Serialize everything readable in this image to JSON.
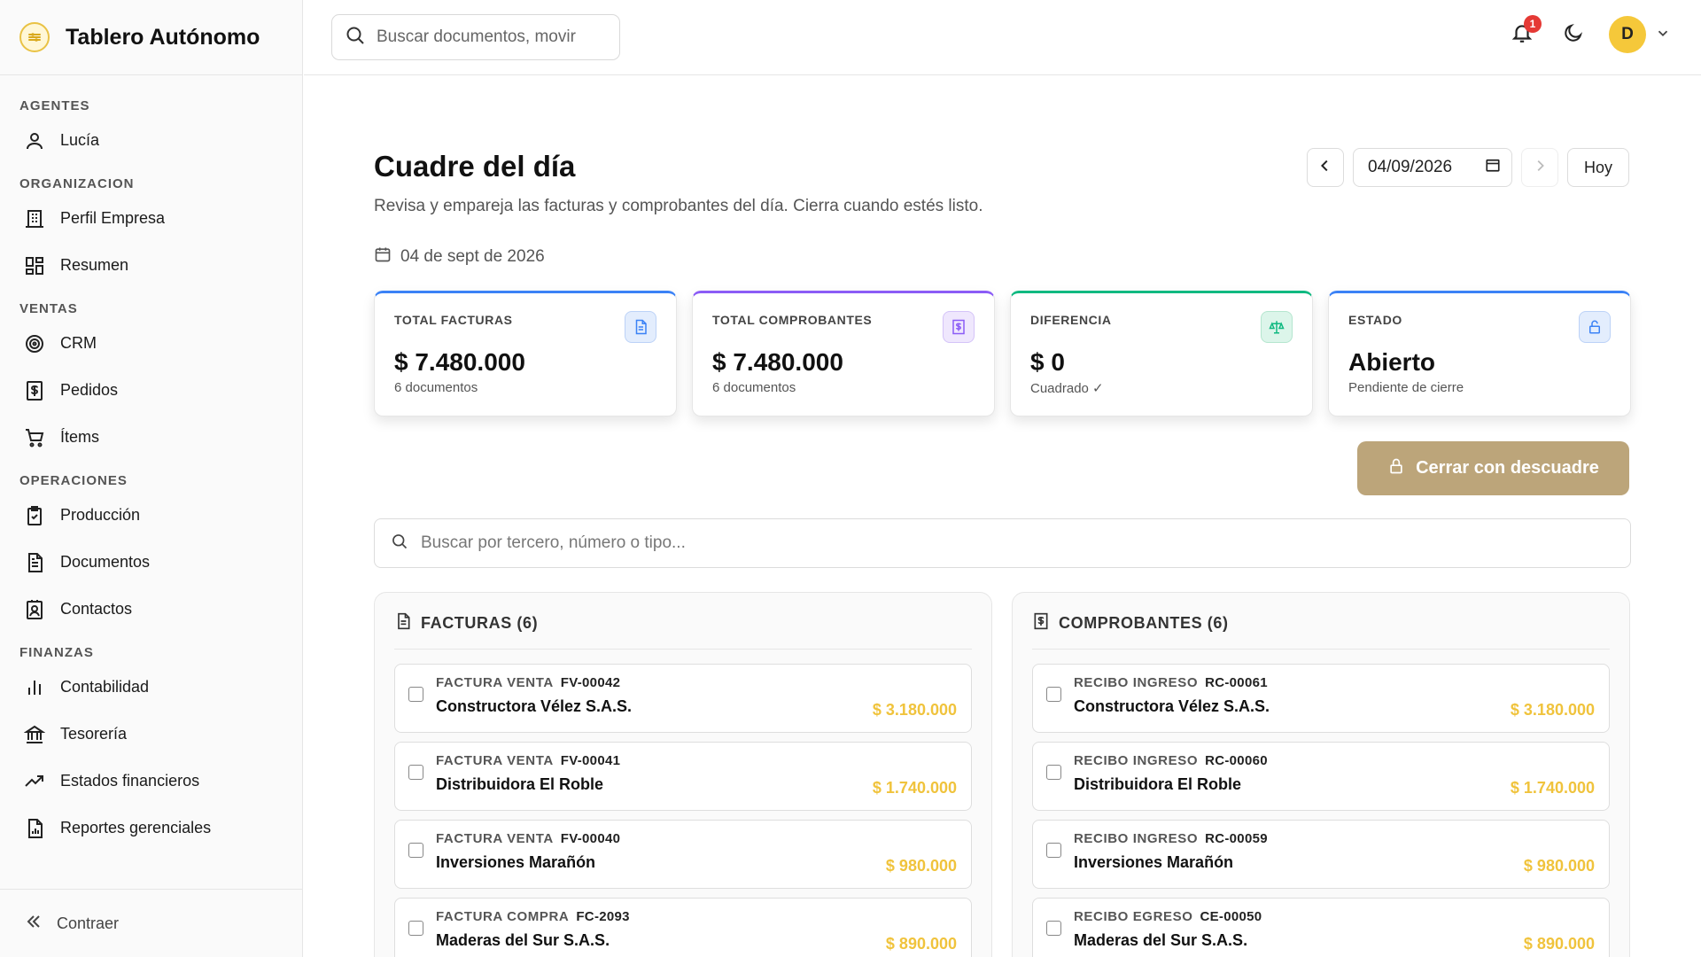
{
  "app": {
    "title": "Tablero Autónomo"
  },
  "search": {
    "placeholder": "Buscar documentos, movir"
  },
  "notifications": {
    "count": "1"
  },
  "user": {
    "initial": "D"
  },
  "sidebar": {
    "sections": {
      "agentes": "AGENTES",
      "organizacion": "ORGANIZACION",
      "ventas": "VENTAS",
      "operaciones": "OPERACIONES",
      "finanzas": "FINANZAS"
    },
    "items": {
      "lucia": "Lucía",
      "perfil": "Perfil Empresa",
      "resumen": "Resumen",
      "crm": "CRM",
      "pedidos": "Pedidos",
      "items": "Ítems",
      "produccion": "Producción",
      "documentos": "Documentos",
      "contactos": "Contactos",
      "contabilidad": "Contabilidad",
      "tesoreria": "Tesorería",
      "estados": "Estados financieros",
      "reportes": "Reportes gerenciales"
    },
    "collapse": "Contraer"
  },
  "page": {
    "title": "Cuadre del día",
    "subtitle": "Revisa y empareja las facturas y comprobantes del día. Cierra cuando estés listo.",
    "date_long": "04 de sept de 2026",
    "date_value": "04/09/2026",
    "today_label": "Hoy"
  },
  "stats": [
    {
      "label": "TOTAL FACTURAS",
      "value": "$ 7.480.000",
      "note": "6 documentos",
      "accent": "#3b82f6"
    },
    {
      "label": "TOTAL COMPROBANTES",
      "value": "$ 7.480.000",
      "note": "6 documentos",
      "accent": "#8b5cf6"
    },
    {
      "label": "DIFERENCIA",
      "value": "$ 0",
      "note": "Cuadrado ✓",
      "accent": "#10b981"
    },
    {
      "label": "ESTADO",
      "value": "Abierto",
      "note": "Pendiente de cierre",
      "accent": "#3b82f6"
    }
  ],
  "close_button": "Cerrar con descuadre",
  "filter": {
    "placeholder": "Buscar por tercero, número o tipo..."
  },
  "facturas": {
    "title": "FACTURAS (6)",
    "rows": [
      {
        "type": "FACTURA VENTA",
        "number": "FV-00042",
        "party": "Constructora Vélez S.A.S.",
        "amount": "$ 3.180.000"
      },
      {
        "type": "FACTURA VENTA",
        "number": "FV-00041",
        "party": "Distribuidora El Roble",
        "amount": "$ 1.740.000"
      },
      {
        "type": "FACTURA VENTA",
        "number": "FV-00040",
        "party": "Inversiones Marañón",
        "amount": "$ 980.000"
      },
      {
        "type": "FACTURA COMPRA",
        "number": "FC-2093",
        "party": "Maderas del Sur S.A.S.",
        "amount": "$ 890.000"
      }
    ]
  },
  "comprobantes": {
    "title": "COMPROBANTES (6)",
    "rows": [
      {
        "type": "RECIBO INGRESO",
        "number": "RC-00061",
        "party": "Constructora Vélez S.A.S.",
        "amount": "$ 3.180.000"
      },
      {
        "type": "RECIBO INGRESO",
        "number": "RC-00060",
        "party": "Distribuidora El Roble",
        "amount": "$ 1.740.000"
      },
      {
        "type": "RECIBO INGRESO",
        "number": "RC-00059",
        "party": "Inversiones Marañón",
        "amount": "$ 980.000"
      },
      {
        "type": "RECIBO EGRESO",
        "number": "CE-00050",
        "party": "Maderas del Sur S.A.S.",
        "amount": "$ 890.000"
      }
    ]
  },
  "colors": {
    "accent_gold": "#bca57a",
    "amount_yellow": "#f0c33c",
    "badge_red": "#e53935"
  }
}
